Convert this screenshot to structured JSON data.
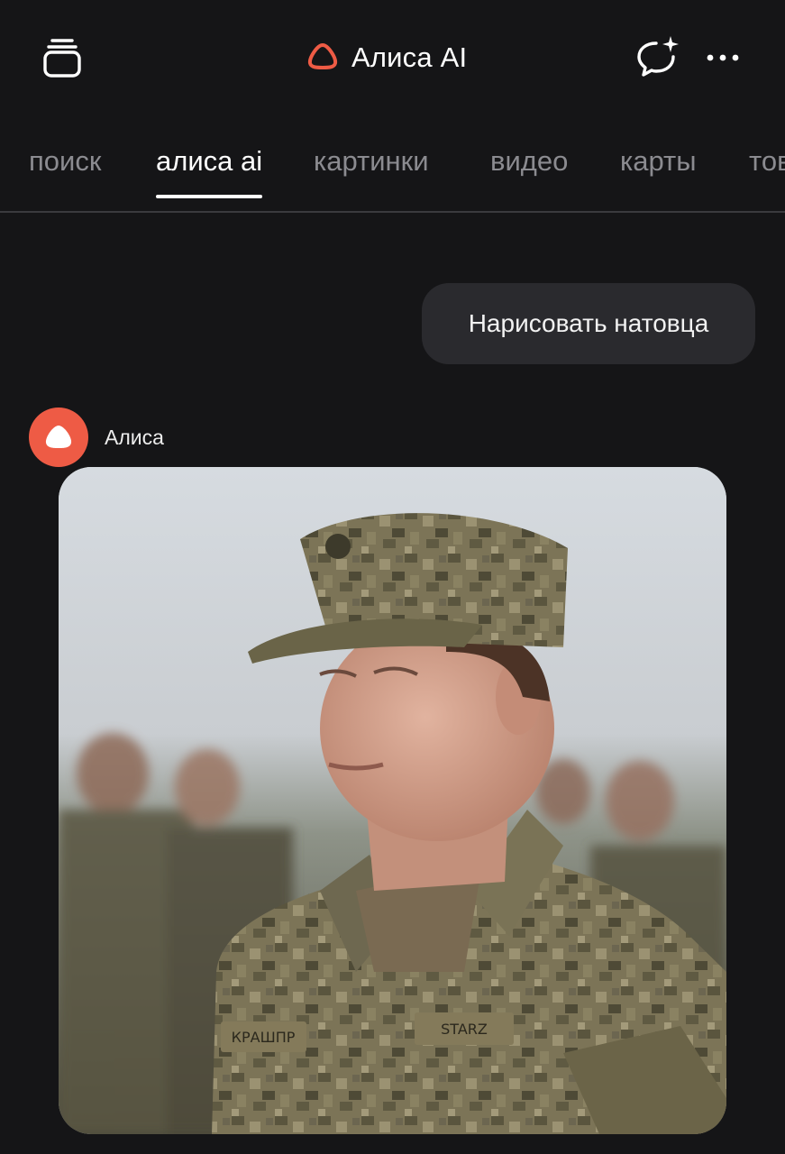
{
  "header": {
    "title": "Алиса AI",
    "brand_color": "#ee5b45",
    "icons": {
      "left": "tabs-stack-icon",
      "right_primary": "new-chat-sparkle-icon",
      "right_secondary": "more-dots-icon"
    }
  },
  "service_tabs": [
    {
      "label": "поиск",
      "active": false
    },
    {
      "label": "алиса ai",
      "active": true
    },
    {
      "label": "картинки",
      "active": false
    },
    {
      "label": "видео",
      "active": false
    },
    {
      "label": "карты",
      "active": false
    },
    {
      "label": "товары",
      "active": false
    }
  ],
  "chat": {
    "user_message": "Нарисовать натовца",
    "assistant": {
      "name": "Алиса",
      "avatar_color": "#ee5b45",
      "image": {
        "name_tape_left": "КРАШПР",
        "name_tape_right": "STARZ"
      }
    }
  },
  "colors": {
    "background": "#151517",
    "bubble": "#2a2a2e",
    "inactive_tab": "#8b8b90",
    "active_tab": "#ffffff"
  }
}
